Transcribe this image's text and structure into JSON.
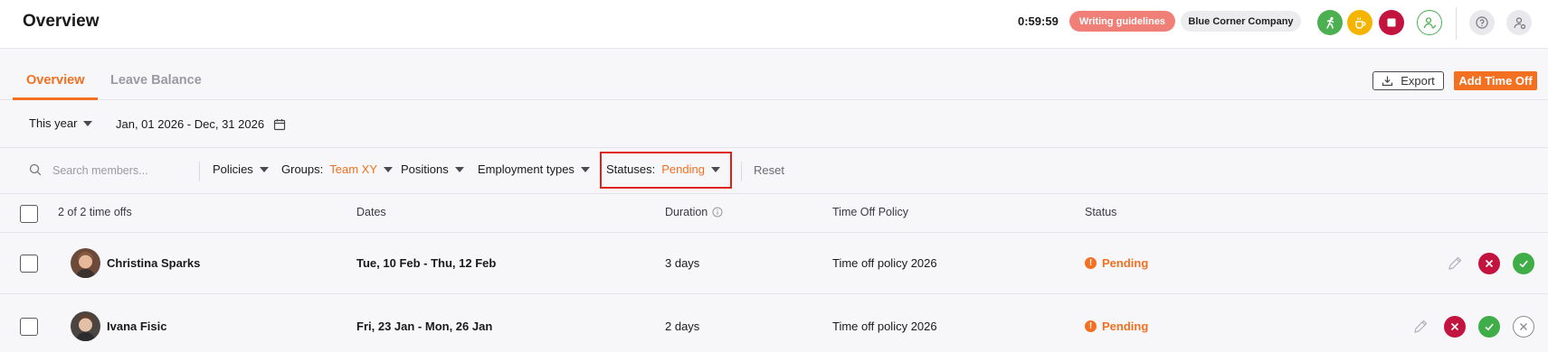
{
  "header": {
    "title": "Overview",
    "timer": "0:59:59",
    "guidelines_label": "Writing guidelines",
    "company_label": "Blue Corner Company",
    "accent_color": "#f37021"
  },
  "tabs": [
    {
      "label": "Overview",
      "active": true
    },
    {
      "label": "Leave Balance",
      "active": false
    }
  ],
  "actions": {
    "export_label": "Export",
    "add_label": "Add Time Off"
  },
  "period": {
    "selector_label": "This year",
    "range_label": "Jan, 01 2026 - Dec, 31 2026"
  },
  "filters": {
    "search_placeholder": "Search members...",
    "policies_label": "Policies",
    "groups_label": "Groups",
    "groups_value": "Team XY",
    "positions_label": "Positions",
    "employment_label": "Employment types",
    "statuses_label": "Statuses",
    "statuses_value": "Pending",
    "reset_label": "Reset"
  },
  "table": {
    "columns": {
      "count": "2 of 2 time offs",
      "dates": "Dates",
      "duration": "Duration",
      "policy": "Time Off Policy",
      "status": "Status"
    },
    "rows": [
      {
        "name": "Christina Sparks",
        "dates": "Tue, 10 Feb - Thu, 12 Feb",
        "duration": "3 days",
        "policy": "Time off policy 2026",
        "status": "Pending"
      },
      {
        "name": "Ivana Fisic",
        "dates": "Fri, 23 Jan - Mon, 26 Jan",
        "duration": "2 days",
        "policy": "Time off policy 2026",
        "status": "Pending"
      }
    ]
  }
}
